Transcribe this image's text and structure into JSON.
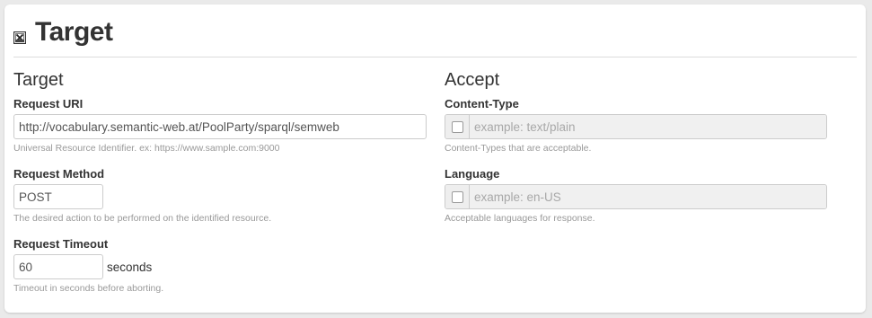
{
  "header": {
    "title": "Target"
  },
  "target": {
    "section_title": "Target",
    "uri": {
      "label": "Request URI",
      "value": "http://vocabulary.semantic-web.at/PoolParty/sparql/semweb",
      "help": "Universal Resource Identifier. ex: https://www.sample.com:9000"
    },
    "method": {
      "label": "Request Method",
      "value": "POST",
      "help": "The desired action to be performed on the identified resource."
    },
    "timeout": {
      "label": "Request Timeout",
      "value": "60",
      "unit": "seconds",
      "help": "Timeout in seconds before aborting."
    }
  },
  "accept": {
    "section_title": "Accept",
    "content_type": {
      "label": "Content-Type",
      "placeholder": "example: text/plain",
      "help": "Content-Types that are acceptable."
    },
    "language": {
      "label": "Language",
      "placeholder": "example: en-US",
      "help": "Acceptable languages for response."
    }
  }
}
